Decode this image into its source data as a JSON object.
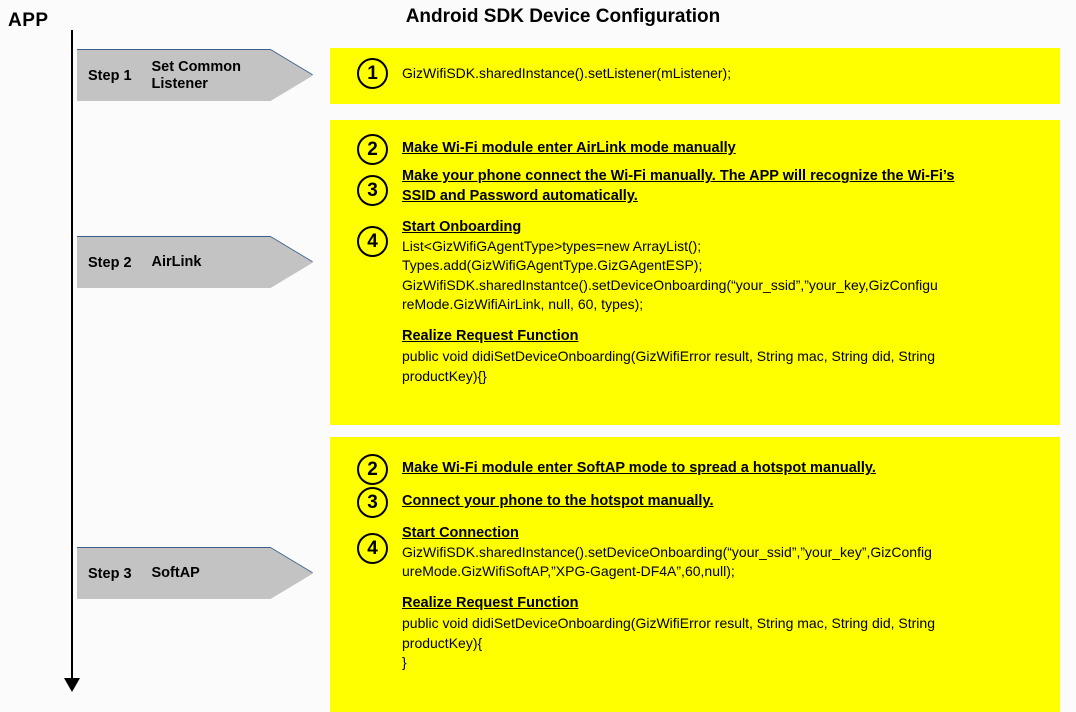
{
  "header": {
    "app_label": "APP",
    "title": "Android SDK Device Configuration"
  },
  "timeline": {
    "axis_icon": "vertical-line",
    "arrow_icon": "down-arrow-icon"
  },
  "steps": [
    {
      "number": "Step 1",
      "name": "Set Common\nListener"
    },
    {
      "number": "Step 2",
      "name": "AirLink"
    },
    {
      "number": "Step 3",
      "name": "SoftAP"
    }
  ],
  "colors": {
    "panel_background": "#ffff00",
    "chevron_fill": "#c3c3c3",
    "chevron_border": "#3a5f8f",
    "text": "#000000",
    "page_background": "#fbfbfb"
  },
  "panels": [
    {
      "id": "panel-set-common-listener",
      "items": [
        {
          "marker": "1",
          "code": "GizWifiSDK.sharedInstance().setListener(mListener);"
        }
      ]
    },
    {
      "id": "panel-airlink",
      "items": [
        {
          "marker": "2",
          "heading": "Make Wi-Fi module enter AirLink mode manually"
        },
        {
          "marker": "3",
          "heading_line1": "Make your phone connect the Wi-Fi manually. The APP will recognize the Wi-Fi’s",
          "heading_line2": "SSID and Password automatically."
        },
        {
          "marker": "4",
          "heading": "Start Onboarding",
          "code_line1": "List<GizWifiGAgentType>types=new ArrayList();",
          "code_line2": "Types.add(GizWifiGAgentType.GizGAgentESP);",
          "code_line3": "GizWifiSDK.sharedInstantce().setDeviceOnboarding(“your_ssid”,”your_key,GizConfigu",
          "code_line4": "reMode.GizWifiAirLink, null, 60, types);"
        }
      ],
      "realize": {
        "heading": "Realize Request Function",
        "code_line1": "public void didiSetDeviceOnboarding(GizWifiError result, String mac, String did, String",
        "code_line2": "productKey){}"
      }
    },
    {
      "id": "panel-softap",
      "items": [
        {
          "marker": "2",
          "heading": "Make Wi-Fi module enter SoftAP mode to spread a hotspot manually."
        },
        {
          "marker": "3",
          "heading": "Connect your phone to the hotspot manually."
        },
        {
          "marker": "4",
          "heading": "Start Connection",
          "code_line1": "GizWifiSDK.sharedInstance().setDeviceOnboarding(“your_ssid”,”your_key”,GizConfig",
          "code_line2": "ureMode.GizWifiSoftAP,”XPG-Gagent-DF4A”,60,null);"
        }
      ],
      "realize": {
        "heading": "Realize Request Function",
        "code_line1": "public void didiSetDeviceOnboarding(GizWifiError result, String mac, String did, String",
        "code_line2": "productKey){",
        "code_line3": "}"
      }
    }
  ]
}
